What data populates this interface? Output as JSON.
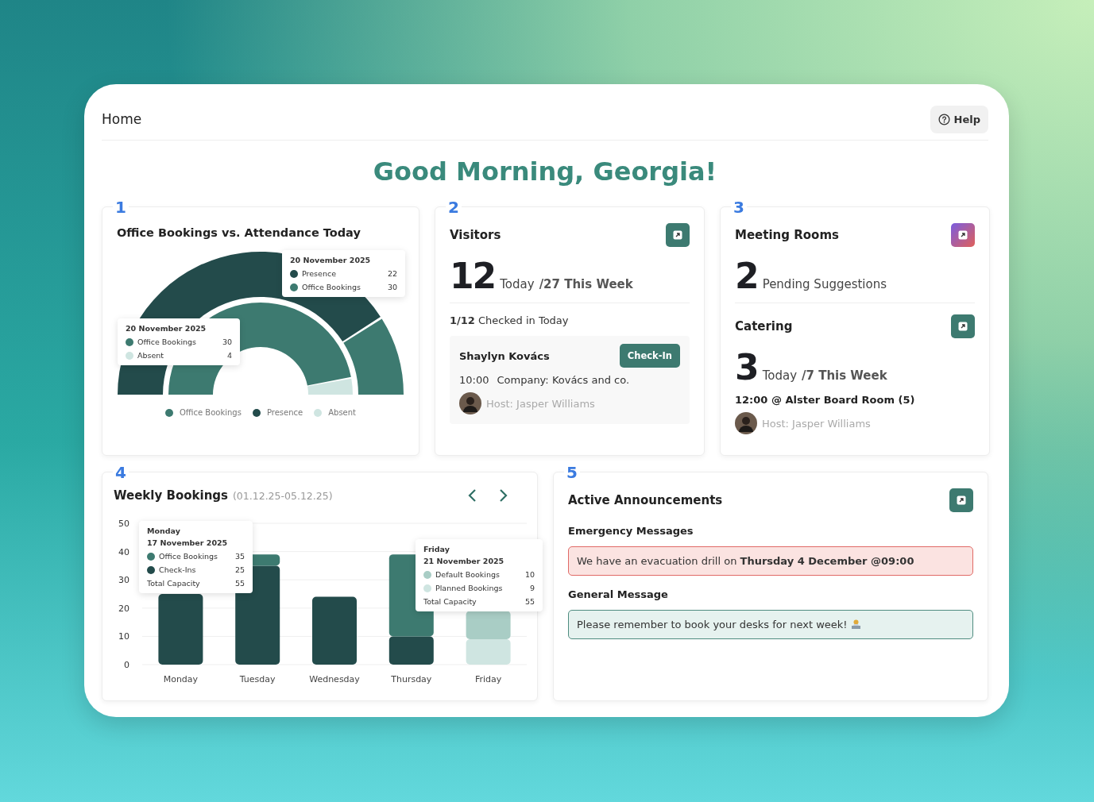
{
  "header": {
    "title": "Home",
    "help_label": "Help"
  },
  "greeting": "Good Morning, Georgia!",
  "attendance": {
    "number": "1",
    "title": "Office Bookings vs. Attendance Today",
    "tooltips": [
      {
        "date": "20 November 2025",
        "rows": [
          {
            "label": "Presence",
            "value": "22",
            "color": "#234b4b"
          },
          {
            "label": "Office Bookings",
            "value": "30",
            "color": "#3d7a70"
          }
        ]
      },
      {
        "date": "20 November 2025",
        "rows": [
          {
            "label": "Office Bookings",
            "value": "30",
            "color": "#3d7a70"
          },
          {
            "label": "Absent",
            "value": "4",
            "color": "#cfe5e1"
          }
        ]
      }
    ],
    "legend": [
      {
        "label": "Office Bookings",
        "color": "#3d7a70"
      },
      {
        "label": "Presence",
        "color": "#234b4b"
      },
      {
        "label": "Absent",
        "color": "#cfe5e1"
      }
    ]
  },
  "visitors": {
    "number": "2",
    "title": "Visitors",
    "kind": "teal",
    "count": "12",
    "today_label": "Today",
    "week_label": "/27 This Week",
    "checked": "**1/12** Checked in Today",
    "visitor": {
      "name": "Shaylyn Kovács",
      "button": "Check-In",
      "time": "10:00",
      "company": "Company: Kovács and co.",
      "host": "Host: Jasper Williams"
    }
  },
  "rooms": {
    "number": "3",
    "title": "Meeting Rooms",
    "kind": "gradient",
    "count": "2",
    "label": "Pending Suggestions",
    "catering": {
      "title": "Catering",
      "kind": "teal",
      "count": "3",
      "today_label": "Today",
      "week_label": "/7 This Week",
      "booking": "12:00 @ Alster Board Room (5)",
      "host": "Host: Jasper Williams"
    }
  },
  "weekly": {
    "number": "4",
    "title": "Weekly Bookings",
    "range": "(01.12.25-05.12.25)",
    "chart_data": {
      "type": "bar",
      "stacked": true,
      "grid": true,
      "categories": [
        "Monday",
        "Tuesday",
        "Wednesday",
        "Thursday",
        "Friday"
      ],
      "ylim": [
        0,
        50
      ],
      "yticks": [
        0,
        10,
        20,
        30,
        40,
        50
      ],
      "series": [
        {
          "color": "#234b4b",
          "values": [
            25,
            35,
            24,
            10,
            null
          ]
        },
        {
          "color": "#3d7a70",
          "values": [
            null,
            4,
            null,
            29,
            null
          ]
        },
        {
          "color": "#cfe5e1",
          "values": [
            null,
            null,
            null,
            null,
            9
          ]
        },
        {
          "color": "#a9cdc5",
          "values": [
            null,
            null,
            null,
            null,
            10
          ]
        }
      ]
    },
    "tooltips": [
      {
        "day": "Monday",
        "date": "17 November 2025",
        "rows": [
          {
            "label": "Office Bookings",
            "value": "35",
            "color": "#3d7a70"
          },
          {
            "label": "Check-Ins",
            "value": "25",
            "color": "#234b4b"
          },
          {
            "label": "Total Capacity",
            "value": "55"
          }
        ]
      },
      {
        "day": "Friday",
        "date": "21 November 2025",
        "rows": [
          {
            "label": "Default Bookings",
            "value": "10",
            "color": "#a9cdc5"
          },
          {
            "label": "Planned Bookings",
            "value": "9",
            "color": "#cfe5e1"
          },
          {
            "label": "Total Capacity",
            "value": "55"
          }
        ]
      }
    ]
  },
  "announcements": {
    "number": "5",
    "title": "Active Announcements",
    "kind": "teal",
    "sections": [
      {
        "heading": "Emergency Messages",
        "kind": "emergency",
        "text": "We have an evacuation drill on **Thursday 4 December @09:00**"
      },
      {
        "heading": "General Message",
        "kind": "general",
        "text": "Please remember to book your desks for next week!"
      }
    ]
  }
}
